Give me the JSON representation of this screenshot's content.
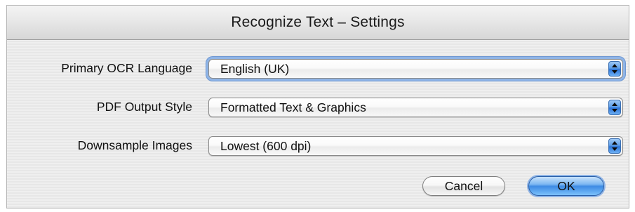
{
  "window": {
    "title": "Recognize Text – Settings"
  },
  "settings": [
    {
      "label": "Primary OCR Language",
      "value": "English (UK)"
    },
    {
      "label": "PDF Output Style",
      "value": "Formatted Text & Graphics"
    },
    {
      "label": "Downsample Images",
      "value": "Lowest (600 dpi)"
    }
  ],
  "buttons": {
    "cancel_label": "Cancel",
    "ok_label": "OK"
  },
  "icons": {
    "popup_arrows": "up-down-arrows-icon"
  },
  "colors": {
    "accent": "#3e8ce4",
    "focus_ring": "#8fb4e6"
  }
}
